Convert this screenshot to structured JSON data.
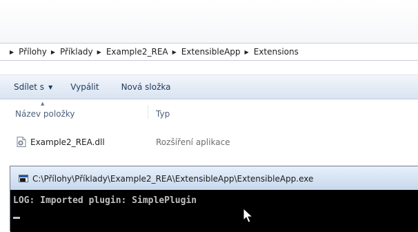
{
  "breadcrumb": {
    "items": [
      "Přílohy",
      "Příklady",
      "Example2_REA",
      "ExtensibleApp",
      "Extensions"
    ]
  },
  "toolbar": {
    "share_label": "Sdílet s",
    "burn_label": "Vypálit",
    "new_folder_label": "Nová složka"
  },
  "columns": {
    "name": "Název položky",
    "type": "Typ"
  },
  "files": [
    {
      "name": "Example2_REA.dll",
      "type": "Rozšíření aplikace",
      "icon": "dll-file-icon"
    }
  ],
  "console": {
    "title": "C:\\Přílohy\\Příklady\\Example2_REA\\ExtensibleApp\\ExtensibleApp.exe",
    "lines": [
      "LOG: Imported plugin: SimplePlugin"
    ]
  },
  "colors": {
    "console_bg": "#000000",
    "console_text": "#c0c0c0",
    "toolbar_text": "#1e395b"
  }
}
